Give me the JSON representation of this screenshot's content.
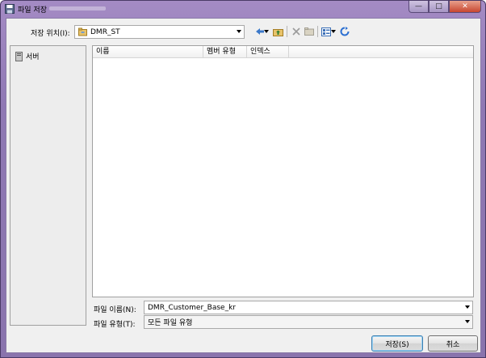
{
  "window": {
    "title": "파일 저장"
  },
  "caption": {
    "minimize": "—",
    "maximize": "□",
    "close": "✕"
  },
  "location": {
    "label": "저장 위치(I):",
    "value": "DMR_ST"
  },
  "places": {
    "items": [
      {
        "label": "서버"
      }
    ]
  },
  "file_list": {
    "columns": [
      "이름",
      "멤버 유형",
      "인덱스"
    ]
  },
  "filename": {
    "label": "파일 이름(N):",
    "value": "DMR_Customer_Base_kr"
  },
  "filetype": {
    "label": "파일 유형(T):",
    "value": "모든 파일 유형"
  },
  "buttons": {
    "save": "저장(S)",
    "cancel": "취소"
  },
  "icons": [
    "save-disk-icon",
    "folder-db-icon",
    "back-arrow-icon",
    "up-folder-icon",
    "delete-icon",
    "new-folder-icon",
    "view-menu-icon",
    "refresh-icon",
    "server-icon"
  ],
  "colors": {
    "title_bar": "#8f78b4",
    "dialog_bg": "#f0f0f0"
  }
}
